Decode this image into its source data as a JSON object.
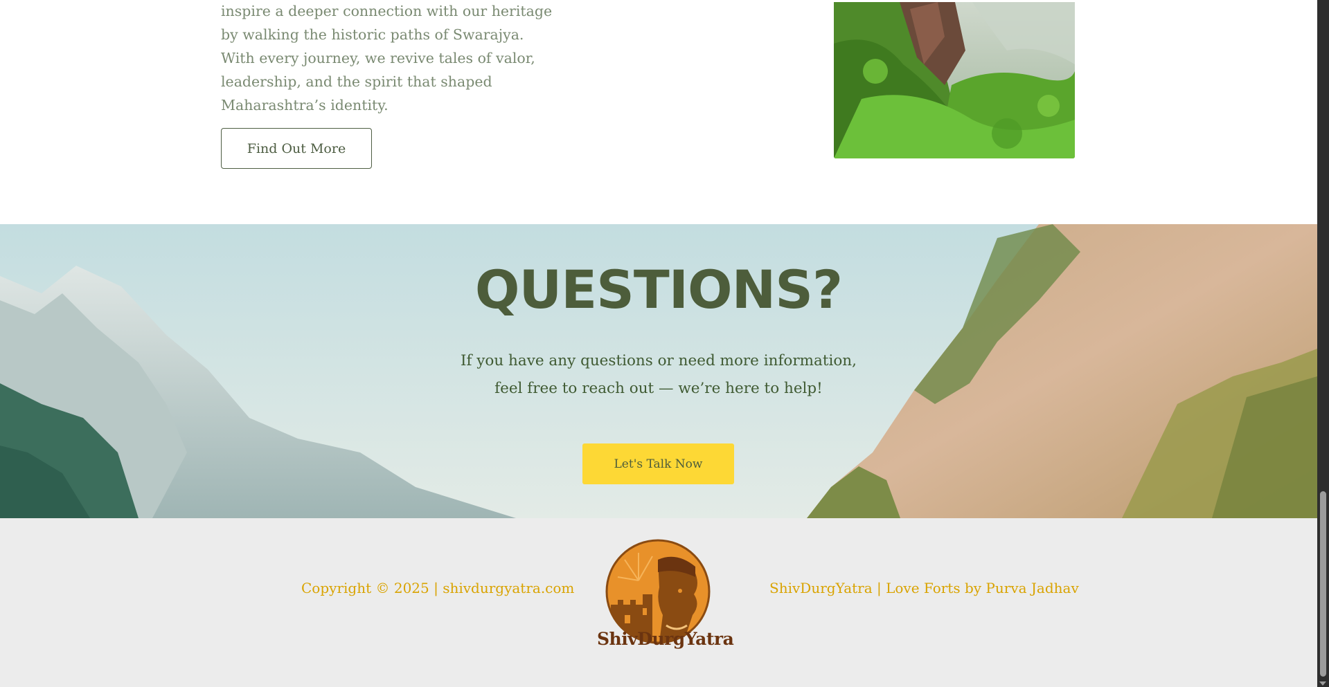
{
  "about": {
    "paragraph": "inspire a deeper connection with our heritage by walking the historic paths of Swarajya. With every journey, we revive tales of valor, leadership, and the spirit that shaped Maharashtra’s identity.",
    "button_label": "Find Out More"
  },
  "questions": {
    "title": "QUESTIONS?",
    "text": "If you have any questions or need more information, feel free to reach out — we’re here to help!",
    "button_label": "Let's Talk Now"
  },
  "footer": {
    "copyright": "Copyright © 2025 | shivdurgyatra.com",
    "logo_text": "ShivDurgYatra",
    "credit": "ShivDurgYatra | Love Forts by Purva Jadhav"
  },
  "colors": {
    "accent_yellow": "#fdd835",
    "heading_green": "#4d5d3b",
    "footer_gold": "#d9a300",
    "logo_orange": "#e8912a",
    "logo_brown": "#6b3410"
  }
}
